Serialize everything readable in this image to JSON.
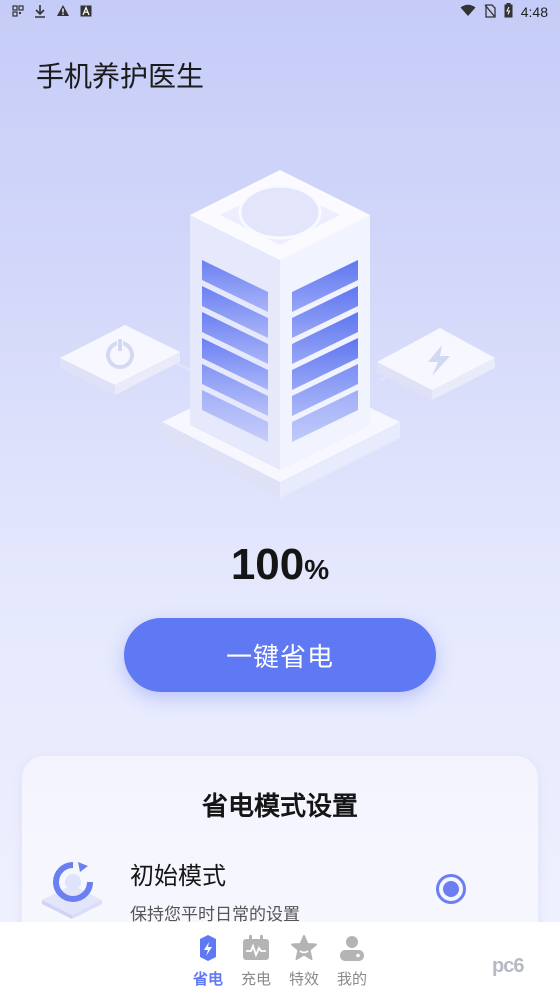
{
  "status_bar": {
    "time": "4:48",
    "left_icons": [
      "qr-icon",
      "download-icon",
      "warning-icon",
      "a-icon"
    ],
    "right_icons": [
      "wifi-icon",
      "no-sim-icon",
      "battery-icon"
    ]
  },
  "app": {
    "title": "手机养护医生"
  },
  "battery": {
    "percent": "100",
    "unit": "%"
  },
  "actions": {
    "save_label": "一键省电"
  },
  "settings_card": {
    "title": "省电模式设置",
    "modes": [
      {
        "name": "初始模式",
        "description": "保持您平时日常的设置",
        "selected": true
      }
    ]
  },
  "tabbar": {
    "items": [
      {
        "label": "省电",
        "icon": "battery-tab-icon",
        "active": true
      },
      {
        "label": "充电",
        "icon": "charge-tab-icon",
        "active": false
      },
      {
        "label": "特效",
        "icon": "star-tab-icon",
        "active": false
      },
      {
        "label": "我的",
        "icon": "user-tab-icon",
        "active": false
      }
    ]
  },
  "watermark": {
    "text": "pc6"
  },
  "colors": {
    "accent": "#5f78f3",
    "background_top": "#c5ccf7",
    "background_bottom": "#f0f2fe"
  }
}
